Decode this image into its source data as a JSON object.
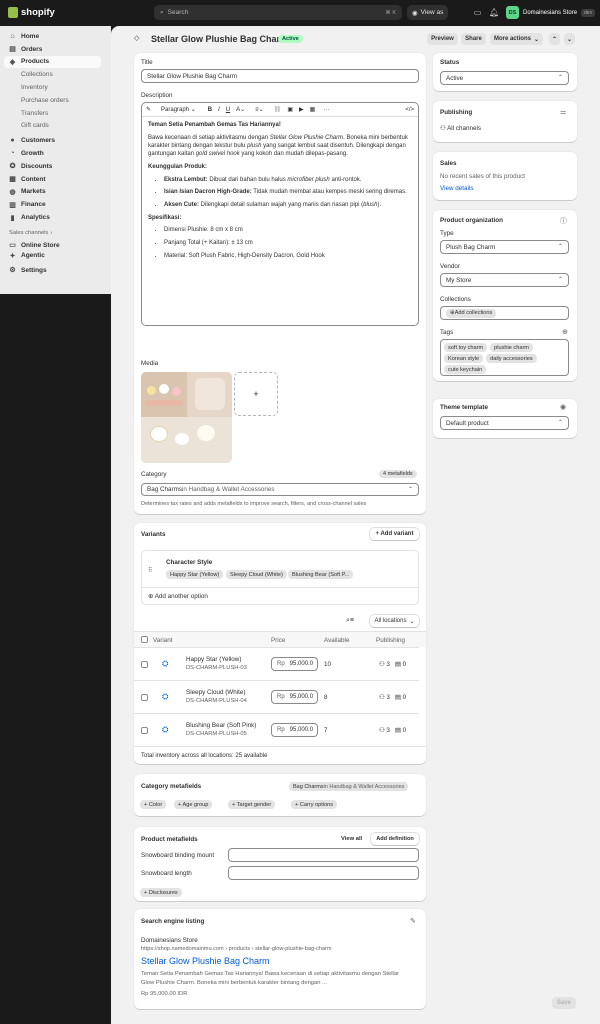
{
  "topbar": {
    "logo": "shopify",
    "search_placeholder": "Search",
    "search_kbd": "⌘ K",
    "view_as": "View as",
    "store_initials": "DS",
    "store_name": "Domainesians Store",
    "store_badge": "dev"
  },
  "sidebar": {
    "items": [
      {
        "label": "Home",
        "icon": "⌂"
      },
      {
        "label": "Orders",
        "icon": "▤"
      },
      {
        "label": "Products",
        "icon": "◈"
      }
    ],
    "product_sub": [
      "Collections",
      "Inventory",
      "Purchase orders",
      "Transfers",
      "Gift cards"
    ],
    "items2": [
      {
        "label": "Customers",
        "icon": "👤"
      },
      {
        "label": "Growth",
        "icon": "◔"
      },
      {
        "label": "Discounts",
        "icon": "✪"
      },
      {
        "label": "Content",
        "icon": "▦"
      },
      {
        "label": "Markets",
        "icon": "◍"
      },
      {
        "label": "Finance",
        "icon": "▥"
      },
      {
        "label": "Analytics",
        "icon": "▮"
      }
    ],
    "sales_channels": "Sales channels",
    "channels": [
      {
        "label": "Online Store",
        "icon": "▭"
      },
      {
        "label": "Agentic",
        "icon": "✦"
      }
    ],
    "settings": "Settings"
  },
  "header": {
    "title": "Stellar Glow Plushie Bag Charm",
    "status_badge": "Active",
    "preview": "Preview",
    "share": "Share",
    "more_actions": "More actions"
  },
  "product": {
    "title_label": "Title",
    "title_value": "Stellar Glow Plushie Bag Charm",
    "description_label": "Description",
    "paragraph": "Paragraph",
    "desc": {
      "h1": "Teman Setia Penambah Gemas Tas Hariannya!",
      "p1a": "Bawa keceriaan di setiap aktivitasmu dengan ",
      "p1b": "Stellar Glow Plushie Charm",
      "p1c": ". Boneka mini berbentuk karakter bintang dengan tekstur bulu ",
      "p1d": "plush",
      "p1e": " yang sangat lembut saat disentuh. Dilengkapi dengan gantungan kaitan ",
      "p1f": "gold swivel hook",
      "p1g": " yang kokoh dan mudah dilepas-pasang.",
      "h2": "Keunggulan Produk:",
      "b1t": "Ekstra Lembut:",
      "b1a": " Dibuat dari bahan bulu halus ",
      "b1b": "microfiber plush",
      "b1c": " anti-rontok.",
      "b2t": "Isian Isian Dacron High-Grade:",
      "b2a": " Tidak mudah membal atau kempes meski sering diremas.",
      "b3t": "Aksen Cute:",
      "b3a": " Dilengkapi detail sulaman wajah yang manis dan riasan pipi (",
      "b3b": "blush",
      "b3c": ").",
      "h3": "Spesifikasi:",
      "s1": "Dimensi Plushie: 8 cm x 8 cm",
      "s2": "Panjang Total (+ Kaitan): ± 13 cm",
      "s3": "Material: Soft Plush Fabric, High-Density Dacron, Gold Hook"
    },
    "media_label": "Media",
    "add_media": "+",
    "category_label": "Category",
    "metafields_badge": "4 metafields",
    "category_value": "Bag Charms",
    "category_path": " in Handbag & Wallet Accessories",
    "category_help": "Determines tax rates and adds metafields to improve search, filters, and cross-channel sales"
  },
  "variants": {
    "title": "Variants",
    "add_variant": "+ Add variant",
    "option_name": "Character Style",
    "option_values": [
      "Happy Star (Yellow)",
      "Sleepy Cloud (White)",
      "Blushing Bear (Soft P..."
    ],
    "add_option": "Add another option",
    "all_locations": "All locations",
    "headers": [
      "Variant",
      "Price",
      "Available",
      "Publishing"
    ],
    "rows": [
      {
        "name": "Happy Star (Yellow)",
        "sku": "DS-CHARM-PLUSH-03",
        "currency": "Rp",
        "price": "95,000.0",
        "available": "10",
        "pub_a": "3",
        "pub_b": "0"
      },
      {
        "name": "Sleepy Cloud (White)",
        "sku": "DS-CHARM-PLUSH-04",
        "currency": "Rp",
        "price": "95,000.0",
        "available": "8",
        "pub_a": "3",
        "pub_b": "0"
      },
      {
        "name": "Blushing Bear (Soft Pink)",
        "sku": "DS-CHARM-PLUSH-05",
        "currency": "Rp",
        "price": "95,000.0",
        "available": "7",
        "pub_a": "3",
        "pub_b": "0"
      }
    ],
    "total": "Total inventory across all locations: 25 available"
  },
  "cat_meta": {
    "title": "Category metafields",
    "badge_a": "Bag Charms",
    "badge_b": " in Handbag & Wallet Accessories",
    "chips": [
      "+ Color",
      "+ Age group",
      "+ Target gender",
      "+ Carry options"
    ]
  },
  "prod_meta": {
    "title": "Product metafields",
    "view_all": "View all",
    "add_def": "Add definition",
    "f1": "Snowboard binding mount",
    "f2": "Snowboard length",
    "disclosures": "+ Disclosures"
  },
  "seo": {
    "title": "Search engine listing",
    "store": "Domainesians Store",
    "url": "https://shop.namedomainmu.com › products › stellar-glow-plushie-bag-charm",
    "headline": "Stellar Glow Plushie Bag Charm",
    "desc": "Teman Setia Penambah Gemas Tas Hariannya! Bawa keceriaan di setiap aktivitasmu dengan Stellar Glow Plushie Charm. Boneka mini berbentuk karakter bintang dengan ...",
    "price": "Rp 95,000.00 IDR"
  },
  "right": {
    "status_label": "Status",
    "status_value": "Active",
    "publishing": "Publishing",
    "all_channels": "All channels",
    "sales": "Sales",
    "sales_empty": "No recent sales of this product",
    "view_details": "View details",
    "org": "Product organization",
    "type_label": "Type",
    "type_value": "Plush Bag Charm",
    "vendor_label": "Vendor",
    "vendor_value": "My Store",
    "collections_label": "Collections",
    "add_collections": "Add collections",
    "tags_label": "Tags",
    "tags": [
      "soft toy charm",
      "plushie charm",
      "Korean style",
      "daily accessories",
      "cute keychain"
    ],
    "theme": "Theme template",
    "theme_value": "Default product"
  },
  "footer": {
    "save": "Save"
  },
  "colors": {
    "accent": "#005bd3",
    "active_badge": "#affebf",
    "sidebar_bg": "#ebebeb",
    "topbar_bg": "#1a1a1a"
  }
}
